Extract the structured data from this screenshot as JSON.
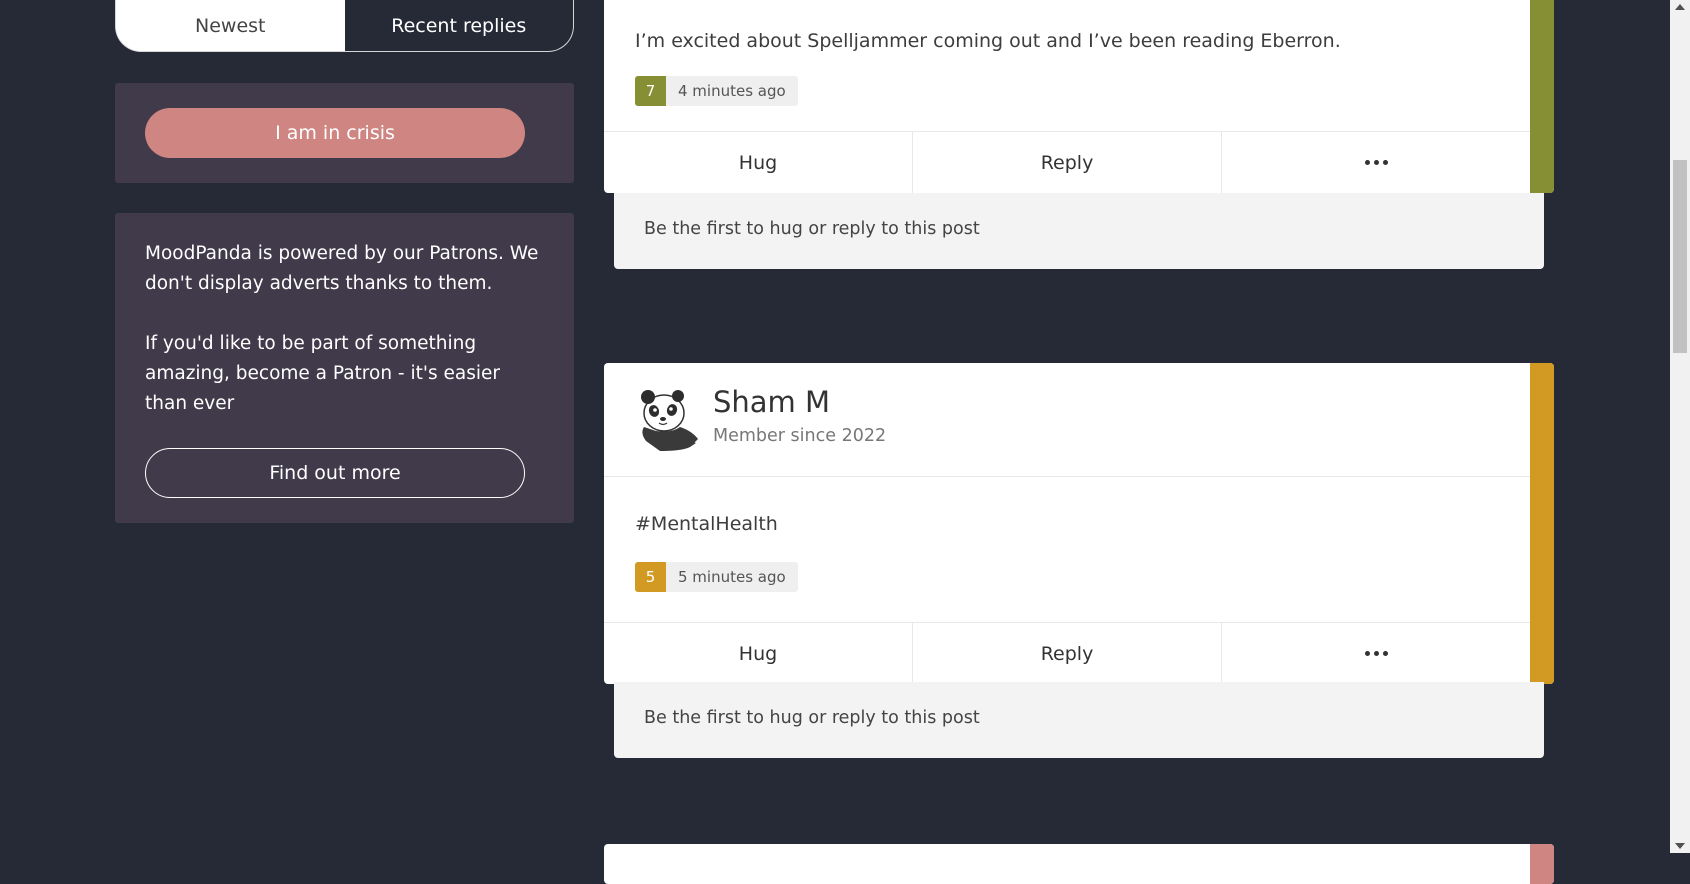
{
  "feed_tabs": {
    "newest": "Newest",
    "recent_replies": "Recent replies"
  },
  "crisis": {
    "label": "I am in crisis"
  },
  "patron": {
    "line1": "MoodPanda is powered by our Patrons. We don't display adverts thanks to them.",
    "line2": "If you'd like to be part of something amazing, become a Patron - it's easier than ever",
    "button": "Find out more"
  },
  "posts": [
    {
      "text": "I’m excited about Spelljammer coming out and I’ve been reading Eberron.",
      "mood": "7",
      "time": "4 minutes ago",
      "color": "#878f35",
      "hug": "Hug",
      "reply": "Reply",
      "comments": "Be the first to hug or reply to this post"
    },
    {
      "username": "Sham M",
      "member_since": "Member since 2022",
      "avatar_icon": "panda-avatar-icon",
      "text": "#MentalHealth",
      "mood": "5",
      "time": "5 minutes ago",
      "color": "#d29a22",
      "hug": "Hug",
      "reply": "Reply",
      "comments": "Be the first to hug or reply to this post"
    },
    {
      "color": "#cf8683"
    }
  ]
}
